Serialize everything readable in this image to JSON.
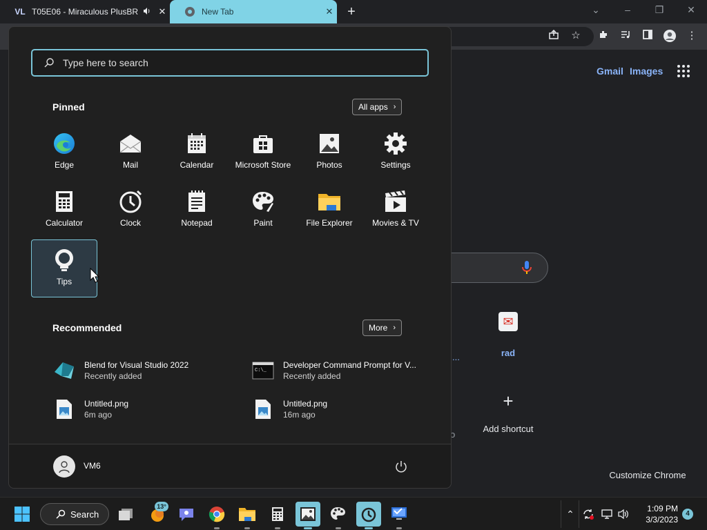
{
  "browser": {
    "tabs": [
      {
        "title": "T05E06 - Miraculous PlusBR",
        "favicon": "VL",
        "audio": true
      },
      {
        "title": "New Tab",
        "favicon": "chrome-icon",
        "active": true
      }
    ],
    "new_tab_label": "+"
  },
  "newtab_page": {
    "links": {
      "gmail": "Gmail",
      "images": "Images"
    },
    "shortcuts": [
      {
        "label": "rad"
      },
      {
        "label": "Add shortcut"
      }
    ],
    "partial_texts": {
      "ellipsis": "...",
      "o": "o"
    },
    "customize_label": "Customize Chrome"
  },
  "start_menu": {
    "search": {
      "placeholder": "Type here to search",
      "value": ""
    },
    "pinned": {
      "title": "Pinned",
      "all_apps_label": "All apps",
      "apps": [
        {
          "name": "Edge",
          "icon": "edge-icon"
        },
        {
          "name": "Mail",
          "icon": "mail-icon"
        },
        {
          "name": "Calendar",
          "icon": "calendar-icon"
        },
        {
          "name": "Microsoft Store",
          "icon": "store-icon"
        },
        {
          "name": "Photos",
          "icon": "photos-icon"
        },
        {
          "name": "Settings",
          "icon": "gear-icon"
        },
        {
          "name": "Calculator",
          "icon": "calculator-icon"
        },
        {
          "name": "Clock",
          "icon": "clock-icon"
        },
        {
          "name": "Notepad",
          "icon": "notepad-icon"
        },
        {
          "name": "Paint",
          "icon": "palette-icon"
        },
        {
          "name": "File Explorer",
          "icon": "folder-icon"
        },
        {
          "name": "Movies & TV",
          "icon": "movies-icon"
        },
        {
          "name": "Tips",
          "icon": "lightbulb-icon",
          "selected": true
        }
      ]
    },
    "recommended": {
      "title": "Recommended",
      "more_label": "More",
      "items": [
        {
          "name": "Blend for Visual Studio 2022",
          "sub": "Recently added",
          "icon": "blend-icon"
        },
        {
          "name": "Developer Command Prompt for V...",
          "sub": "Recently added",
          "icon": "terminal-icon"
        },
        {
          "name": "Untitled.png",
          "sub": "6m ago",
          "icon": "image-file-icon"
        },
        {
          "name": "Untitled.png",
          "sub": "16m ago",
          "icon": "image-file-icon"
        }
      ]
    },
    "user": {
      "name": "VM6"
    }
  },
  "taskbar": {
    "search_label": "Search",
    "weather_badge": "13°",
    "clock": {
      "time": "1:09 PM",
      "date": "3/3/2023"
    },
    "notification_count": "4"
  },
  "colors": {
    "accent": "#7ac5d8",
    "start_bg": "#202020",
    "chrome_bg": "#202124",
    "link": "#8ab4f8"
  }
}
